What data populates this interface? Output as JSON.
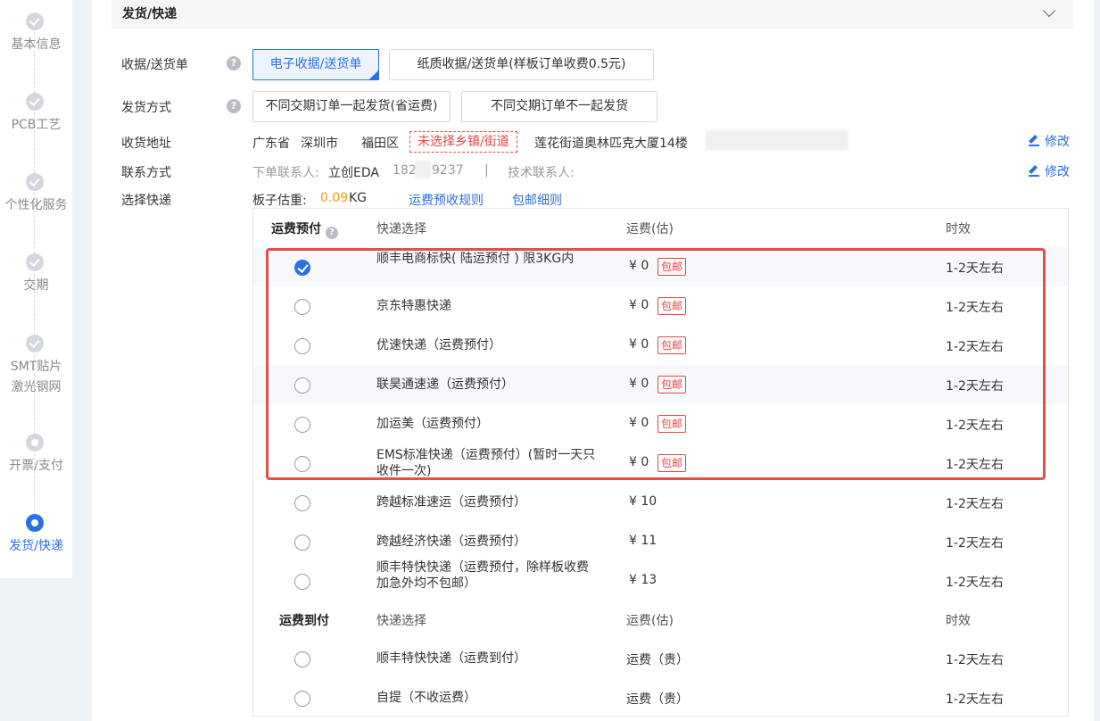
{
  "sidebar": {
    "steps": [
      {
        "label": "基本信息",
        "state": "done"
      },
      {
        "label": "PCB工艺",
        "state": "done"
      },
      {
        "label": "个性化服务",
        "state": "done"
      },
      {
        "label": "交期",
        "state": "done"
      },
      {
        "label": "SMT贴片",
        "label2": "激光钢网",
        "state": "done"
      },
      {
        "label": "开票/支付",
        "state": "pending"
      },
      {
        "label": "发货/快递",
        "state": "active"
      }
    ]
  },
  "section": {
    "title": "发货/快递"
  },
  "receipt": {
    "label": "收据/送货单",
    "help": "?",
    "options": [
      "电子收据/送货单",
      "纸质收据/送货单(样板订单收费0.5元)"
    ],
    "selected": 0
  },
  "ship_method": {
    "label": "发货方式",
    "help": "?",
    "options": [
      "不同交期订单一起发货(省运费)",
      "不同交期订单不一起发货"
    ]
  },
  "address": {
    "label": "收货地址",
    "province": "广东省",
    "city": "深圳市",
    "district": "福田区",
    "town_warning": "未选择乡镇/街道",
    "detail": "莲花街道奥林匹克大厦14楼",
    "edit": "修改"
  },
  "contact": {
    "label": "联系方式",
    "order_contact_label": "下单联系人:",
    "order_contact_value": "立创EDA",
    "phone_start": "182",
    "phone_end": "9237",
    "sep": "|",
    "tech_contact_label": "技术联系人:",
    "edit": "修改"
  },
  "courier": {
    "label": "选择快递",
    "weight_label": "板子估重:",
    "weight_value": "0.09",
    "weight_unit": "KG",
    "link_rules": "运费预收规则",
    "link_free": "包邮细则"
  },
  "table": {
    "prepaid_header": {
      "group": "运费预付",
      "col_courier": "快递选择",
      "col_fee": "运费(估)",
      "col_time": "时效"
    },
    "prepaid_rows": [
      {
        "name": "顺丰电商标快( 陆运预付 )     限3KG内",
        "fee": "¥ 0",
        "free": "包邮",
        "time": "1-2天左右",
        "selected": true
      },
      {
        "name": "京东特惠快递",
        "fee": "¥ 0",
        "free": "包邮",
        "time": "1-2天左右",
        "selected": false
      },
      {
        "name": "优速快递（运费预付）",
        "fee": "¥ 0",
        "free": "包邮",
        "time": "1-2天左右",
        "selected": false
      },
      {
        "name": "联昊通速递（运费预付）",
        "fee": "¥ 0",
        "free": "包邮",
        "time": "1-2天左右",
        "selected": false
      },
      {
        "name": "加运美（运费预付）",
        "fee": "¥ 0",
        "free": "包邮",
        "time": "1-2天左右",
        "selected": false
      },
      {
        "name": "EMS标准快递（运费预付）(暂时一天只收件一次)",
        "fee": "¥ 0",
        "free": "包邮",
        "time": "1-2天左右",
        "selected": false
      },
      {
        "name": "跨越标准速运（运费预付）",
        "fee": "¥ 10",
        "free": "",
        "time": "1-2天左右",
        "selected": false
      },
      {
        "name": "跨越经济快递（运费预付）",
        "fee": "¥ 11",
        "free": "",
        "time": "1-2天左右",
        "selected": false
      },
      {
        "name": "顺丰特快快递（运费预付，除样板收费加急外均不包邮）",
        "fee": "¥ 13",
        "free": "",
        "time": "1-2天左右",
        "selected": false
      }
    ],
    "cod_header": {
      "group": "运费到付",
      "col_courier": "快递选择",
      "col_fee": "运费(估)",
      "col_time": "时效"
    },
    "cod_rows": [
      {
        "name": "顺丰特快快递（运费到付）",
        "fee": "运费（贵）",
        "time": "1-2天左右"
      },
      {
        "name": "自提（不收运费）",
        "fee": "运费（贵）",
        "time": "1-2天左右"
      }
    ]
  }
}
